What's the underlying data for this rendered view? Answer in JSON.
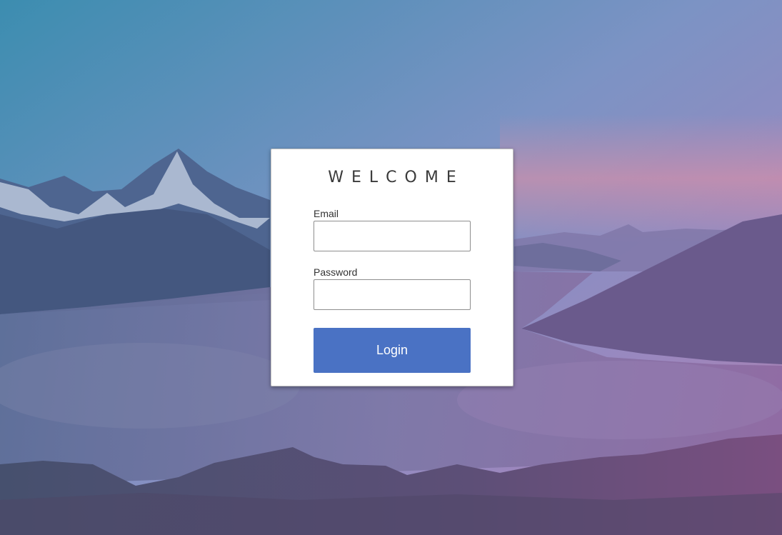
{
  "login": {
    "title": "WELCOME",
    "email_label": "Email",
    "email_value": "",
    "password_label": "Password",
    "password_value": "",
    "login_label": "Login"
  },
  "colors": {
    "button": "#4a72c4",
    "card": "#ffffff"
  }
}
